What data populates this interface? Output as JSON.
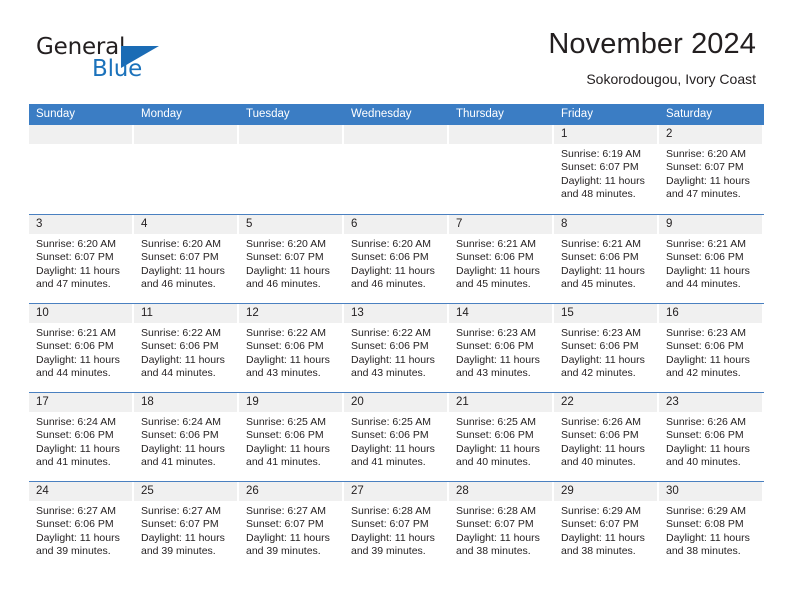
{
  "brand": {
    "name_part1": "General",
    "name_part2": "Blue",
    "accent_color": "#1b72bb"
  },
  "header": {
    "title": "November 2024",
    "subtitle": "Sokorodougou, Ivory Coast"
  },
  "calendar": {
    "header_color": "#3b7dc4",
    "day_headers": [
      "Sunday",
      "Monday",
      "Tuesday",
      "Wednesday",
      "Thursday",
      "Friday",
      "Saturday"
    ],
    "weeks": [
      [
        {
          "day": "",
          "sunrise": "",
          "sunset": "",
          "daylight_line1": "",
          "daylight_line2": ""
        },
        {
          "day": "",
          "sunrise": "",
          "sunset": "",
          "daylight_line1": "",
          "daylight_line2": ""
        },
        {
          "day": "",
          "sunrise": "",
          "sunset": "",
          "daylight_line1": "",
          "daylight_line2": ""
        },
        {
          "day": "",
          "sunrise": "",
          "sunset": "",
          "daylight_line1": "",
          "daylight_line2": ""
        },
        {
          "day": "",
          "sunrise": "",
          "sunset": "",
          "daylight_line1": "",
          "daylight_line2": ""
        },
        {
          "day": "1",
          "sunrise": "Sunrise: 6:19 AM",
          "sunset": "Sunset: 6:07 PM",
          "daylight_line1": "Daylight: 11 hours",
          "daylight_line2": "and 48 minutes."
        },
        {
          "day": "2",
          "sunrise": "Sunrise: 6:20 AM",
          "sunset": "Sunset: 6:07 PM",
          "daylight_line1": "Daylight: 11 hours",
          "daylight_line2": "and 47 minutes."
        }
      ],
      [
        {
          "day": "3",
          "sunrise": "Sunrise: 6:20 AM",
          "sunset": "Sunset: 6:07 PM",
          "daylight_line1": "Daylight: 11 hours",
          "daylight_line2": "and 47 minutes."
        },
        {
          "day": "4",
          "sunrise": "Sunrise: 6:20 AM",
          "sunset": "Sunset: 6:07 PM",
          "daylight_line1": "Daylight: 11 hours",
          "daylight_line2": "and 46 minutes."
        },
        {
          "day": "5",
          "sunrise": "Sunrise: 6:20 AM",
          "sunset": "Sunset: 6:07 PM",
          "daylight_line1": "Daylight: 11 hours",
          "daylight_line2": "and 46 minutes."
        },
        {
          "day": "6",
          "sunrise": "Sunrise: 6:20 AM",
          "sunset": "Sunset: 6:06 PM",
          "daylight_line1": "Daylight: 11 hours",
          "daylight_line2": "and 46 minutes."
        },
        {
          "day": "7",
          "sunrise": "Sunrise: 6:21 AM",
          "sunset": "Sunset: 6:06 PM",
          "daylight_line1": "Daylight: 11 hours",
          "daylight_line2": "and 45 minutes."
        },
        {
          "day": "8",
          "sunrise": "Sunrise: 6:21 AM",
          "sunset": "Sunset: 6:06 PM",
          "daylight_line1": "Daylight: 11 hours",
          "daylight_line2": "and 45 minutes."
        },
        {
          "day": "9",
          "sunrise": "Sunrise: 6:21 AM",
          "sunset": "Sunset: 6:06 PM",
          "daylight_line1": "Daylight: 11 hours",
          "daylight_line2": "and 44 minutes."
        }
      ],
      [
        {
          "day": "10",
          "sunrise": "Sunrise: 6:21 AM",
          "sunset": "Sunset: 6:06 PM",
          "daylight_line1": "Daylight: 11 hours",
          "daylight_line2": "and 44 minutes."
        },
        {
          "day": "11",
          "sunrise": "Sunrise: 6:22 AM",
          "sunset": "Sunset: 6:06 PM",
          "daylight_line1": "Daylight: 11 hours",
          "daylight_line2": "and 44 minutes."
        },
        {
          "day": "12",
          "sunrise": "Sunrise: 6:22 AM",
          "sunset": "Sunset: 6:06 PM",
          "daylight_line1": "Daylight: 11 hours",
          "daylight_line2": "and 43 minutes."
        },
        {
          "day": "13",
          "sunrise": "Sunrise: 6:22 AM",
          "sunset": "Sunset: 6:06 PM",
          "daylight_line1": "Daylight: 11 hours",
          "daylight_line2": "and 43 minutes."
        },
        {
          "day": "14",
          "sunrise": "Sunrise: 6:23 AM",
          "sunset": "Sunset: 6:06 PM",
          "daylight_line1": "Daylight: 11 hours",
          "daylight_line2": "and 43 minutes."
        },
        {
          "day": "15",
          "sunrise": "Sunrise: 6:23 AM",
          "sunset": "Sunset: 6:06 PM",
          "daylight_line1": "Daylight: 11 hours",
          "daylight_line2": "and 42 minutes."
        },
        {
          "day": "16",
          "sunrise": "Sunrise: 6:23 AM",
          "sunset": "Sunset: 6:06 PM",
          "daylight_line1": "Daylight: 11 hours",
          "daylight_line2": "and 42 minutes."
        }
      ],
      [
        {
          "day": "17",
          "sunrise": "Sunrise: 6:24 AM",
          "sunset": "Sunset: 6:06 PM",
          "daylight_line1": "Daylight: 11 hours",
          "daylight_line2": "and 41 minutes."
        },
        {
          "day": "18",
          "sunrise": "Sunrise: 6:24 AM",
          "sunset": "Sunset: 6:06 PM",
          "daylight_line1": "Daylight: 11 hours",
          "daylight_line2": "and 41 minutes."
        },
        {
          "day": "19",
          "sunrise": "Sunrise: 6:25 AM",
          "sunset": "Sunset: 6:06 PM",
          "daylight_line1": "Daylight: 11 hours",
          "daylight_line2": "and 41 minutes."
        },
        {
          "day": "20",
          "sunrise": "Sunrise: 6:25 AM",
          "sunset": "Sunset: 6:06 PM",
          "daylight_line1": "Daylight: 11 hours",
          "daylight_line2": "and 41 minutes."
        },
        {
          "day": "21",
          "sunrise": "Sunrise: 6:25 AM",
          "sunset": "Sunset: 6:06 PM",
          "daylight_line1": "Daylight: 11 hours",
          "daylight_line2": "and 40 minutes."
        },
        {
          "day": "22",
          "sunrise": "Sunrise: 6:26 AM",
          "sunset": "Sunset: 6:06 PM",
          "daylight_line1": "Daylight: 11 hours",
          "daylight_line2": "and 40 minutes."
        },
        {
          "day": "23",
          "sunrise": "Sunrise: 6:26 AM",
          "sunset": "Sunset: 6:06 PM",
          "daylight_line1": "Daylight: 11 hours",
          "daylight_line2": "and 40 minutes."
        }
      ],
      [
        {
          "day": "24",
          "sunrise": "Sunrise: 6:27 AM",
          "sunset": "Sunset: 6:06 PM",
          "daylight_line1": "Daylight: 11 hours",
          "daylight_line2": "and 39 minutes."
        },
        {
          "day": "25",
          "sunrise": "Sunrise: 6:27 AM",
          "sunset": "Sunset: 6:07 PM",
          "daylight_line1": "Daylight: 11 hours",
          "daylight_line2": "and 39 minutes."
        },
        {
          "day": "26",
          "sunrise": "Sunrise: 6:27 AM",
          "sunset": "Sunset: 6:07 PM",
          "daylight_line1": "Daylight: 11 hours",
          "daylight_line2": "and 39 minutes."
        },
        {
          "day": "27",
          "sunrise": "Sunrise: 6:28 AM",
          "sunset": "Sunset: 6:07 PM",
          "daylight_line1": "Daylight: 11 hours",
          "daylight_line2": "and 39 minutes."
        },
        {
          "day": "28",
          "sunrise": "Sunrise: 6:28 AM",
          "sunset": "Sunset: 6:07 PM",
          "daylight_line1": "Daylight: 11 hours",
          "daylight_line2": "and 38 minutes."
        },
        {
          "day": "29",
          "sunrise": "Sunrise: 6:29 AM",
          "sunset": "Sunset: 6:07 PM",
          "daylight_line1": "Daylight: 11 hours",
          "daylight_line2": "and 38 minutes."
        },
        {
          "day": "30",
          "sunrise": "Sunrise: 6:29 AM",
          "sunset": "Sunset: 6:08 PM",
          "daylight_line1": "Daylight: 11 hours",
          "daylight_line2": "and 38 minutes."
        }
      ]
    ]
  }
}
